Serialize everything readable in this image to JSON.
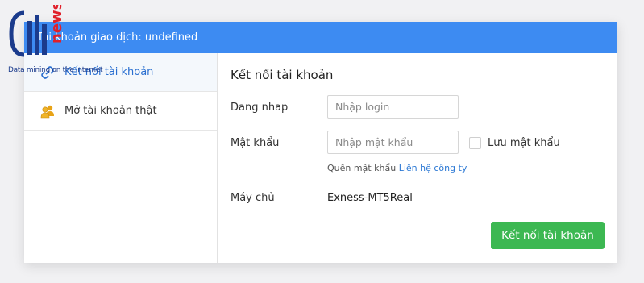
{
  "watermark": {
    "logo_text": "news",
    "tagline": "Data mining on the internet"
  },
  "header": {
    "title": "Tài khoản giao dịch: undefined"
  },
  "sidebar": {
    "items": [
      {
        "label": "Kết nối tài khoản",
        "icon": "link-icon",
        "active": true
      },
      {
        "label": "Mở tài khoản thật",
        "icon": "users-icon",
        "active": false
      }
    ]
  },
  "form": {
    "title": "Kết nối tài khoản",
    "login_label": "Dang nhap",
    "login_placeholder": "Nhập login",
    "password_label": "Mật khẩu",
    "password_placeholder": "Nhập mật khẩu",
    "remember_label": "Lưu mật khẩu",
    "forgot_text": "Quên mật khẩu",
    "contact_link": "Liên hệ công ty",
    "server_label": "Máy chủ",
    "server_value": "Exness-MT5Real",
    "submit_label": "Kết nối tài khoản"
  },
  "colors": {
    "header_bg": "#3d8bf2",
    "button_bg": "#3cb852",
    "link": "#2b78d4"
  }
}
